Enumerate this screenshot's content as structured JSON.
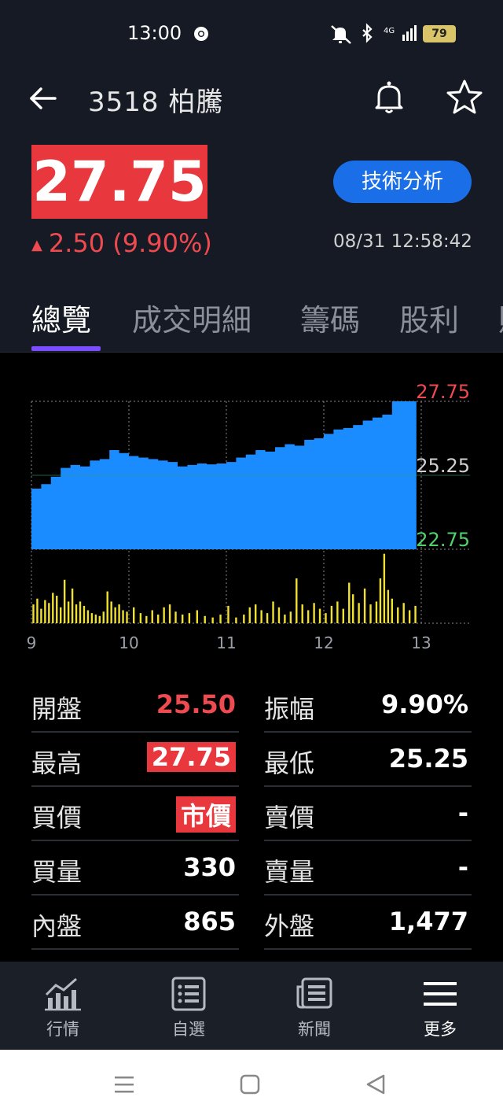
{
  "status_bar": {
    "time": "13:00",
    "network": "4G",
    "battery": "79",
    "icons": [
      "chrome-icon",
      "mute-icon",
      "bluetooth-icon",
      "signal-icon",
      "battery-icon"
    ]
  },
  "header": {
    "title": "3518 柏騰",
    "icons": [
      "back-arrow-icon",
      "bell-icon",
      "star-icon"
    ]
  },
  "quote": {
    "price": "27.75",
    "change": "2.50 (9.90%)",
    "timestamp": "08/31 12:58:42",
    "ta_button": "技術分析",
    "colors": {
      "up": "#ef4a4f",
      "accent": "#1a6fe8",
      "tab_indicator": "#7c4dff"
    }
  },
  "tabs": [
    {
      "label": "總覽",
      "active": true
    },
    {
      "label": "成交明細",
      "active": false
    },
    {
      "label": "籌碼",
      "active": false
    },
    {
      "label": "股利",
      "active": false
    },
    {
      "label": "財",
      "active": false
    }
  ],
  "chart_data": {
    "type": "area",
    "x_ticks": [
      "9",
      "10",
      "11",
      "12",
      "13"
    ],
    "y_labels": {
      "high": "27.75",
      "ref": "25.25",
      "low": "22.75"
    },
    "ylim": [
      22.75,
      27.75
    ],
    "grid": true,
    "price": [
      [
        9.0,
        24.8
      ],
      [
        9.1,
        24.95
      ],
      [
        9.2,
        25.2
      ],
      [
        9.3,
        25.5
      ],
      [
        9.4,
        25.6
      ],
      [
        9.5,
        25.55
      ],
      [
        9.6,
        25.75
      ],
      [
        9.7,
        25.8
      ],
      [
        9.8,
        26.1
      ],
      [
        9.9,
        26.0
      ],
      [
        10.0,
        25.9
      ],
      [
        10.1,
        25.85
      ],
      [
        10.2,
        25.8
      ],
      [
        10.3,
        25.75
      ],
      [
        10.4,
        25.7
      ],
      [
        10.5,
        25.55
      ],
      [
        10.6,
        25.6
      ],
      [
        10.7,
        25.65
      ],
      [
        10.8,
        25.62
      ],
      [
        10.9,
        25.65
      ],
      [
        11.0,
        25.7
      ],
      [
        11.1,
        25.85
      ],
      [
        11.2,
        25.95
      ],
      [
        11.3,
        26.1
      ],
      [
        11.4,
        26.05
      ],
      [
        11.5,
        26.2
      ],
      [
        11.6,
        26.3
      ],
      [
        11.7,
        26.25
      ],
      [
        11.8,
        26.45
      ],
      [
        11.9,
        26.5
      ],
      [
        12.0,
        26.65
      ],
      [
        12.1,
        26.8
      ],
      [
        12.2,
        26.85
      ],
      [
        12.3,
        26.95
      ],
      [
        12.4,
        27.1
      ],
      [
        12.5,
        27.2
      ],
      [
        12.6,
        27.3
      ],
      [
        12.7,
        27.75
      ],
      [
        12.8,
        27.75
      ],
      [
        12.95,
        27.75
      ]
    ],
    "volume": [
      [
        9.02,
        26
      ],
      [
        9.06,
        34
      ],
      [
        9.1,
        20
      ],
      [
        9.14,
        32
      ],
      [
        9.18,
        28
      ],
      [
        9.22,
        42
      ],
      [
        9.26,
        38
      ],
      [
        9.3,
        22
      ],
      [
        9.34,
        60
      ],
      [
        9.38,
        30
      ],
      [
        9.42,
        48
      ],
      [
        9.46,
        26
      ],
      [
        9.5,
        30
      ],
      [
        9.54,
        24
      ],
      [
        9.58,
        18
      ],
      [
        9.62,
        14
      ],
      [
        9.66,
        12
      ],
      [
        9.7,
        10
      ],
      [
        9.74,
        16
      ],
      [
        9.78,
        44
      ],
      [
        9.82,
        30
      ],
      [
        9.86,
        22
      ],
      [
        9.9,
        26
      ],
      [
        9.94,
        18
      ],
      [
        9.98,
        16
      ],
      [
        10.05,
        22
      ],
      [
        10.12,
        14
      ],
      [
        10.18,
        10
      ],
      [
        10.24,
        18
      ],
      [
        10.3,
        12
      ],
      [
        10.36,
        22
      ],
      [
        10.42,
        26
      ],
      [
        10.48,
        16
      ],
      [
        10.55,
        12
      ],
      [
        10.62,
        14
      ],
      [
        10.7,
        18
      ],
      [
        10.78,
        10
      ],
      [
        10.86,
        8
      ],
      [
        10.94,
        12
      ],
      [
        11.02,
        24
      ],
      [
        11.1,
        8
      ],
      [
        11.18,
        12
      ],
      [
        11.24,
        22
      ],
      [
        11.3,
        26
      ],
      [
        11.36,
        18
      ],
      [
        11.42,
        14
      ],
      [
        11.48,
        30
      ],
      [
        11.54,
        22
      ],
      [
        11.6,
        12
      ],
      [
        11.66,
        16
      ],
      [
        11.72,
        62
      ],
      [
        11.78,
        26
      ],
      [
        11.84,
        18
      ],
      [
        11.9,
        28
      ],
      [
        11.96,
        20
      ],
      [
        12.02,
        14
      ],
      [
        12.08,
        24
      ],
      [
        12.14,
        30
      ],
      [
        12.2,
        20
      ],
      [
        12.26,
        56
      ],
      [
        12.3,
        40
      ],
      [
        12.36,
        28
      ],
      [
        12.42,
        48
      ],
      [
        12.48,
        26
      ],
      [
        12.54,
        30
      ],
      [
        12.58,
        62
      ],
      [
        12.62,
        96
      ],
      [
        12.66,
        46
      ],
      [
        12.7,
        34
      ],
      [
        12.76,
        22
      ],
      [
        12.82,
        28
      ],
      [
        12.88,
        18
      ],
      [
        12.94,
        24
      ]
    ],
    "vol_max": 100
  },
  "stats": {
    "left": [
      {
        "label": "開盤",
        "value": "25.50",
        "style": "up"
      },
      {
        "label": "最高",
        "value": "27.75",
        "style": "badge"
      },
      {
        "label": "買價",
        "value": "市價",
        "style": "badge"
      },
      {
        "label": "買量",
        "value": "330",
        "style": "plain"
      },
      {
        "label": "內盤",
        "value": "865",
        "style": "plain"
      }
    ],
    "right": [
      {
        "label": "振幅",
        "value": "9.90%",
        "style": "plain"
      },
      {
        "label": "最低",
        "value": "25.25",
        "style": "plain"
      },
      {
        "label": "賣價",
        "value": "-",
        "style": "plain"
      },
      {
        "label": "賣量",
        "value": "-",
        "style": "plain"
      },
      {
        "label": "外盤",
        "value": "1,477",
        "style": "plain"
      }
    ]
  },
  "bottom_nav": [
    {
      "label": "行情",
      "icon": "market-chart-icon",
      "active": false
    },
    {
      "label": "自選",
      "icon": "watchlist-icon",
      "active": false
    },
    {
      "label": "新聞",
      "icon": "news-icon",
      "active": false
    },
    {
      "label": "更多",
      "icon": "hamburger-menu-icon",
      "active": true
    }
  ]
}
